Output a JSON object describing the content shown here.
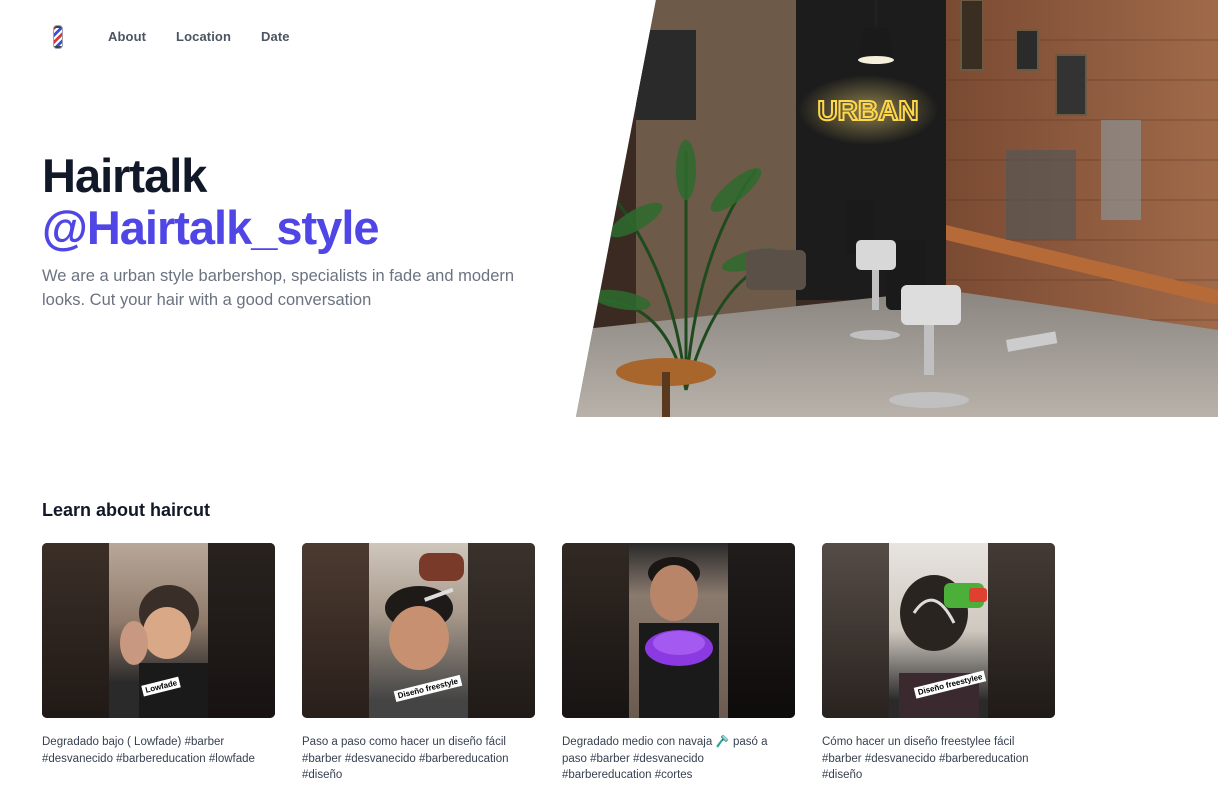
{
  "header": {
    "logo": "barber-pole-logo",
    "nav": [
      "About",
      "Location",
      "Date"
    ]
  },
  "hero": {
    "title": "Hairtalk",
    "handle": "@Hairtalk_style",
    "description": "We are a urban style barbershop, specialists in fade and modern looks. Cut your hair with a good conversation",
    "image_sign": "URBAN",
    "accent_color": "#4f46e5"
  },
  "section": {
    "title": "Learn about haircut",
    "videos": [
      {
        "tag": "Lowfade",
        "caption": "Degradado bajo ( Lowfade) #barber #desvanecido #barbereducation #lowfade"
      },
      {
        "tag": "Diseño freestyle",
        "caption": "Paso a paso como hacer un diseño fácil #barber #desvanecido #barbereducation #diseño"
      },
      {
        "tag": "",
        "caption": "Degradado medio con navaja 🪒 pasó a paso #barber #desvanecido #barbereducation #cortes"
      },
      {
        "tag": "Diseño freestylee",
        "caption": "Cómo hacer un diseño freestylee fácil #barber #desvanecido #barbereducation #diseño"
      }
    ]
  }
}
